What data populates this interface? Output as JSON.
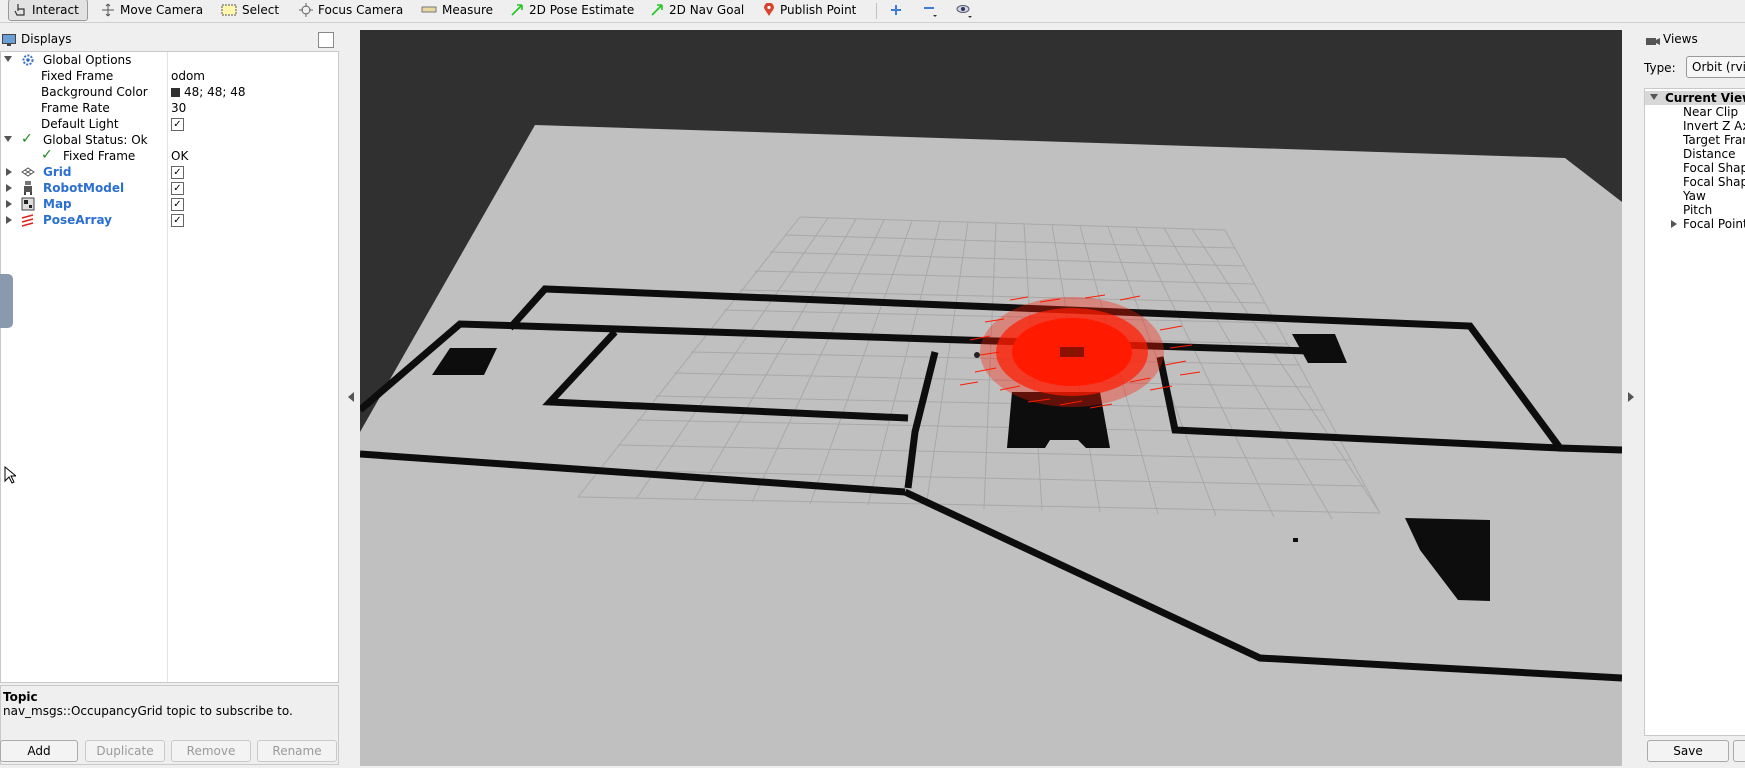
{
  "toolbar": {
    "tools": [
      {
        "label": "Interact",
        "icon": "hand-pointer-icon",
        "active": true
      },
      {
        "label": "Move Camera",
        "icon": "move-camera-icon"
      },
      {
        "label": "Select",
        "icon": "select-rectangle-icon"
      },
      {
        "label": "Focus Camera",
        "icon": "focus-crosshair-icon"
      },
      {
        "label": "Measure",
        "icon": "ruler-icon"
      },
      {
        "label": "2D Pose Estimate",
        "icon": "green-arrow-icon"
      },
      {
        "label": "2D Nav Goal",
        "icon": "green-arrow-icon"
      },
      {
        "label": "Publish Point",
        "icon": "map-pin-icon"
      }
    ]
  },
  "displays": {
    "title": "Displays",
    "items": [
      {
        "label": "Global Options"
      },
      {
        "label": "Fixed Frame",
        "value": "odom"
      },
      {
        "label": "Background Color",
        "value": "48; 48; 48"
      },
      {
        "label": "Frame Rate",
        "value": "30"
      },
      {
        "label": "Default Light",
        "checked": true
      },
      {
        "label": "Global Status: Ok"
      },
      {
        "label": "Fixed Frame",
        "value": "OK"
      },
      {
        "label": "Grid",
        "checked": true
      },
      {
        "label": "RobotModel",
        "checked": true
      },
      {
        "label": "Map",
        "checked": true
      },
      {
        "label": "PoseArray",
        "checked": true
      }
    ],
    "description": {
      "heading": "Topic",
      "body": "nav_msgs::OccupancyGrid topic to subscribe to."
    },
    "buttons": {
      "add": "Add",
      "duplicate": "Duplicate",
      "remove": "Remove",
      "rename": "Rename"
    }
  },
  "views": {
    "title": "Views",
    "type_label": "Type:",
    "type_value": "Orbit (rviz)",
    "current_view": "Current View",
    "rows": [
      "Near Clip",
      "Invert Z Axis",
      "Target Frame",
      "Distance",
      "Focal Shape Size",
      "Focal Shape Fixed Size",
      "Yaw",
      "Pitch",
      "Focal Point"
    ],
    "save_label": "Save"
  },
  "colors": {
    "background": "#303030",
    "map_free": "#c0c0c0",
    "map_occupied": "#0a0a0a",
    "pose_array": "#ff1a00",
    "status_ok": "#1e8a1e",
    "link_blue": "#2a6fd2"
  }
}
